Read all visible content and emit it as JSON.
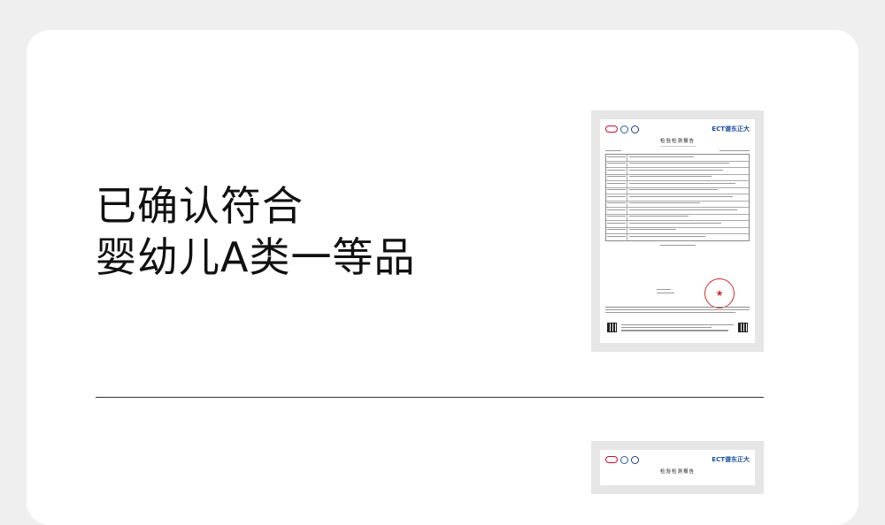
{
  "headline": {
    "line1": "已确认符合",
    "line2": "婴幼儿A类一等品"
  },
  "report": {
    "brand": "ECT谱东正大",
    "title": "检验检测报告",
    "stamp_icon": "star-icon"
  },
  "colors": {
    "background": "#efefef",
    "card": "#ffffff",
    "text": "#111111",
    "divider": "#333333",
    "seal_red": "#d42a2a",
    "brand_blue": "#1d4fa0"
  }
}
